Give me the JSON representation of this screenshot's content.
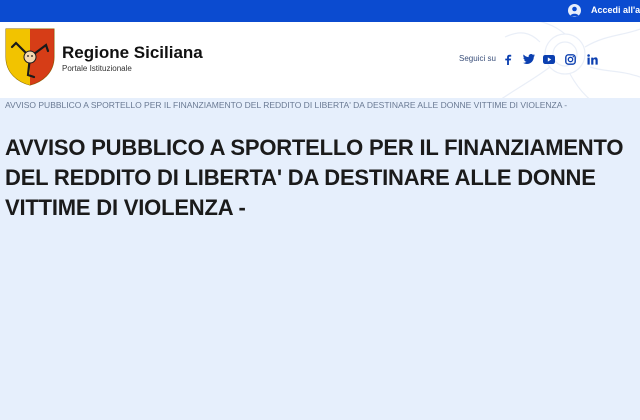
{
  "topbar": {
    "login_label": "Accedi all'area"
  },
  "header": {
    "title": "Regione Siciliana",
    "subtitle": "Portale Istituzionale",
    "social_label": "Seguici su",
    "social": [
      "facebook-icon",
      "twitter-icon",
      "youtube-icon",
      "instagram-icon",
      "linkedin-icon"
    ]
  },
  "breadcrumb": {
    "text": "AVVISO PUBBLICO A SPORTELLO PER IL FINANZIAMENTO DEL REDDITO DI LIBERTA' DA DESTINARE ALLE DONNE VITTIME DI VIOLENZA -"
  },
  "main": {
    "title": "AVVISO PUBBLICO A SPORTELLO PER IL FINANZIAMENTO DEL REDDITO DI LIBERTA' DA DESTINARE ALLE DONNE VITTIME DI VIOLENZA -"
  },
  "colors": {
    "topbar": "#0b4bd0",
    "background": "#e6effc",
    "social_icons": "#0b3fb0",
    "logo_yellow": "#f2c300",
    "logo_red": "#d1261b"
  }
}
